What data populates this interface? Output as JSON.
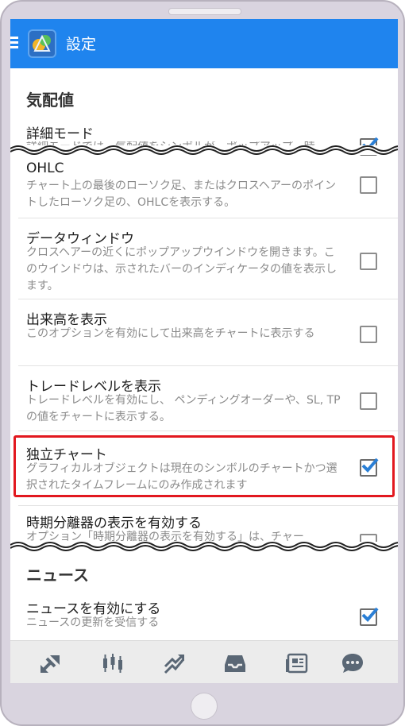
{
  "appbar": {
    "title": "設定"
  },
  "sections": {
    "quotes": "気配値",
    "news": "ニュース"
  },
  "items": {
    "detail_mode": {
      "title": "詳細モード",
      "desc_fragment": "詳細モードでは、気配値をシンボルが、ポップアップ…時",
      "checked": true
    },
    "ohlc": {
      "title": "OHLC",
      "desc": "チャート上の最後のローソク足、またはクロスヘアーのポイントしたローソク足の、OHLCを表示する。",
      "checked": false
    },
    "data_window": {
      "title": "データウィンドウ",
      "desc": "クロスヘアーの近くにポップアップウインドウを開きます。このウインドウは、示されたバーのインディケータの値を表示します。",
      "checked": false
    },
    "show_volume": {
      "title": "出来高を表示",
      "desc": "このオプションを有効にして出来高をチャートに表示する",
      "checked": false
    },
    "trade_levels": {
      "title": "トレードレベルを表示",
      "desc": "トレードレベルを有効にし、 ペンディングオーダーや、SL, TP の値をチャートに表示する。",
      "checked": false
    },
    "independent_chart": {
      "title": "独立チャート",
      "desc": "グラフィカルオブジェクトは現在のシンボルのチャートかつ選択されたタイムフレームにのみ作成されます",
      "checked": true
    },
    "period_separator": {
      "title": "時期分離器の表示を有効する",
      "desc_fragment": "オプション「時期分離器の表示を有効する」は、チャー",
      "checked": false
    },
    "enable_news": {
      "title": "ニュースを有効にする",
      "desc": "ニュースの更新を受信する",
      "checked": true
    }
  },
  "bottom_nav": {
    "icons": [
      "quotes-icon",
      "chart-candles-icon",
      "trade-icon",
      "history-inbox-icon",
      "news-icon",
      "chat-icon"
    ]
  },
  "colors": {
    "appbar": "#1f84ee",
    "checkmark": "#2a7fd6",
    "highlight": "#e2181f",
    "nav_icon": "#5a6775"
  }
}
